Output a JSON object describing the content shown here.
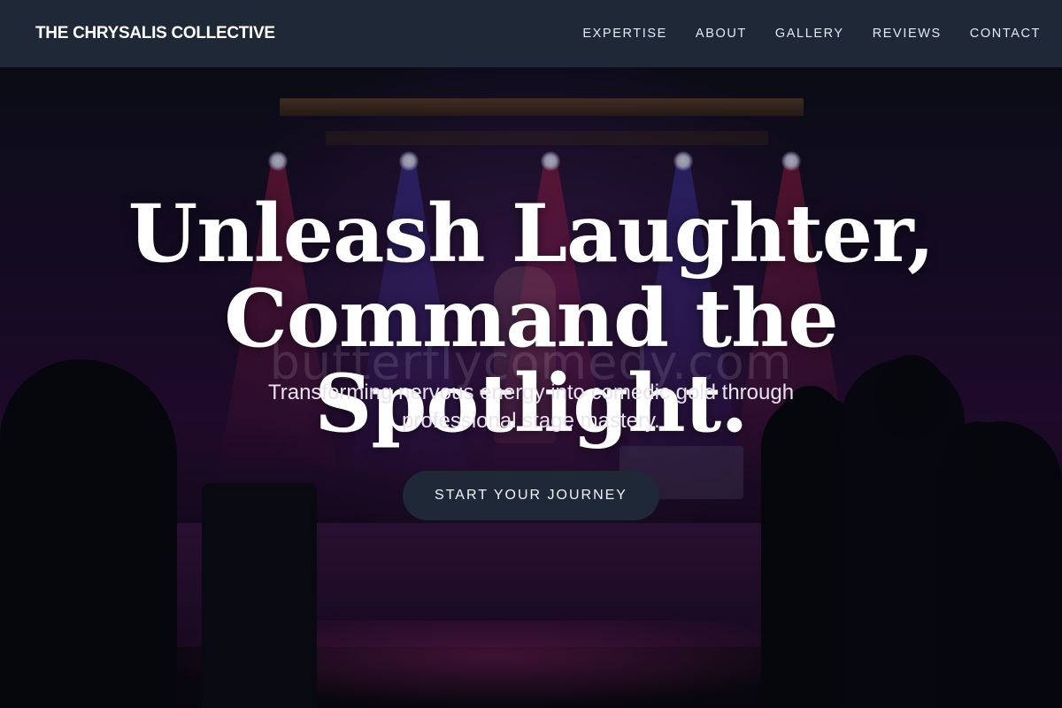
{
  "nav": {
    "brand": "THE CHRYSALIS COLLECTIVE",
    "links": [
      "EXPERTISE",
      "ABOUT",
      "GALLERY",
      "REVIEWS",
      "CONTACT"
    ]
  },
  "hero": {
    "headline_line1": "Unleash Laughter,",
    "headline_line2": "Command the Spotlight.",
    "subtitle": "Transforming nervous energy into comedic gold through professional stage mastery.",
    "cta_label": "START YOUR JOURNEY",
    "watermark": "butterflycomedy.com"
  },
  "colors": {
    "navbar": "#1f2837",
    "cta": "#1f2837",
    "text": "#ffffff"
  }
}
